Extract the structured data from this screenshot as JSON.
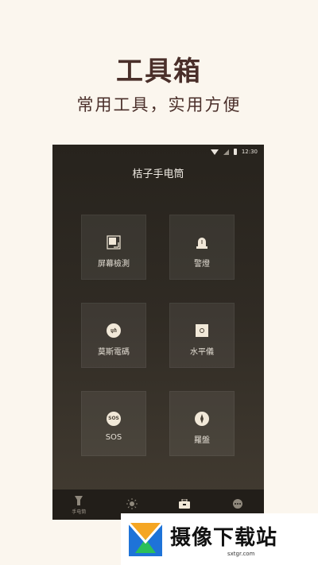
{
  "promo": {
    "title": "工具箱",
    "subtitle": "常用工具，实用方便"
  },
  "status_bar": {
    "time": "12:30"
  },
  "app": {
    "title": "桔子手电筒"
  },
  "tools": [
    {
      "label": "屏幕檢測",
      "icon": "screen-check-icon"
    },
    {
      "label": "警燈",
      "icon": "alarm-light-icon"
    },
    {
      "label": "莫斯電碼",
      "icon": "morse-code-icon"
    },
    {
      "label": "水平儀",
      "icon": "level-icon"
    },
    {
      "label": "SOS",
      "icon": "sos-icon",
      "badge": "SOS"
    },
    {
      "label": "羅盤",
      "icon": "compass-icon"
    }
  ],
  "tab_bar": {
    "tabs": [
      {
        "label": "手电筒",
        "icon": "flashlight-icon"
      },
      {
        "label": "",
        "icon": "brightness-icon"
      },
      {
        "label": "",
        "icon": "toolbox-icon"
      },
      {
        "label": "",
        "icon": "more-icon"
      }
    ]
  },
  "watermark": {
    "title": "摄像下载站",
    "url": "sxtgr.com"
  },
  "colors": {
    "background": "#fbf6ee",
    "title_text": "#4a2f2a",
    "phone_bg_top": "#27231d",
    "phone_bg_bottom": "#433c32",
    "icon_fill": "#f1e8d8"
  }
}
